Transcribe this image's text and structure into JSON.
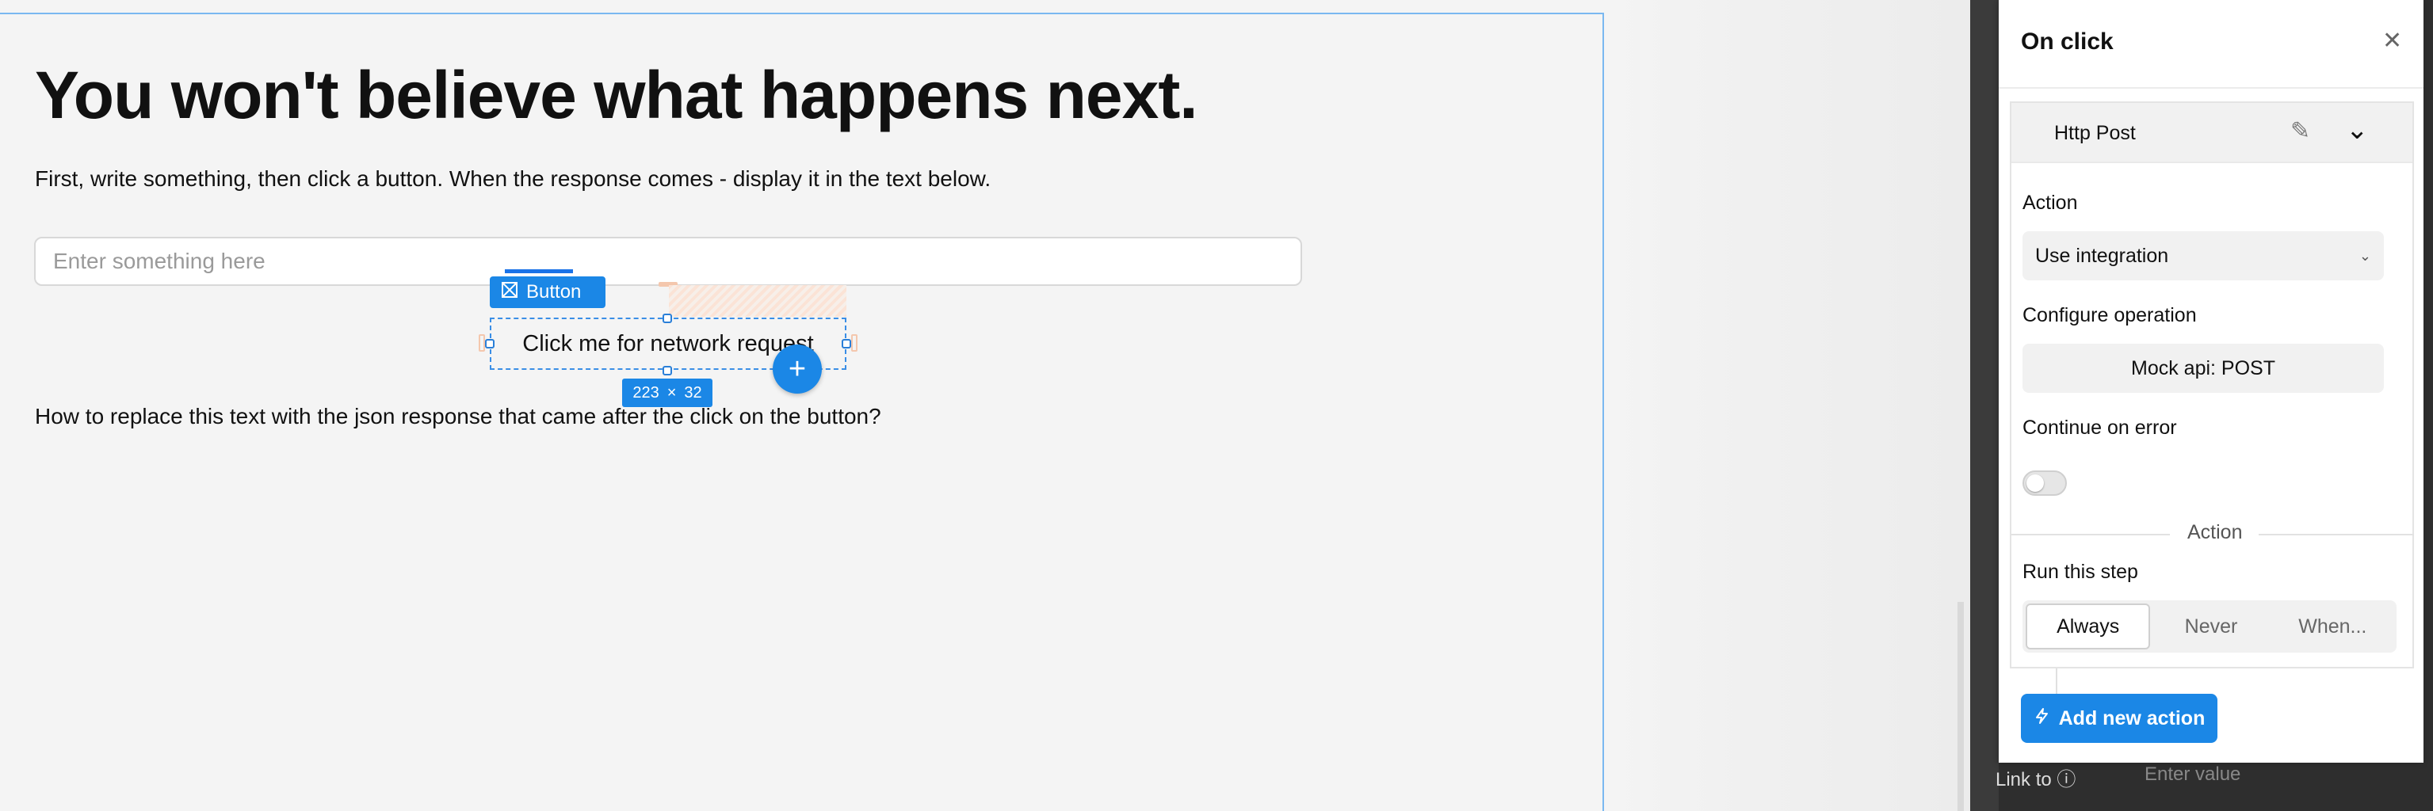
{
  "canvas": {
    "heading": "You won't believe what happens next.",
    "intro": "First, write something, then click a button. When the response comes - display it in the text below.",
    "input_placeholder": "Enter something here",
    "button_label": "Click me for network request",
    "footer_text": "How to replace this text with the json response that came after the click on the button?"
  },
  "selection": {
    "component_chip": "Button",
    "component_icon": "component-icon",
    "size_w": "223",
    "size_sep": "×",
    "size_h": "32",
    "add_icon": "plus-icon"
  },
  "panel": {
    "title": "On click",
    "close_icon": "close-icon",
    "card_title": "Http Post",
    "action_label": "Action",
    "action_value": "Use integration",
    "configure_label": "Configure operation",
    "operation_value": "Mock api: POST",
    "continue_label": "Continue on error",
    "continue_on_error": false,
    "divider_label": "Action",
    "run_label": "Run this step",
    "run_options": [
      "Always",
      "Never",
      "When..."
    ],
    "run_selected": "Always",
    "add_action": "Add new action"
  },
  "behind": {
    "link_label": "Link to",
    "link_placeholder": "Enter value"
  },
  "colors": {
    "accent": "#1b87e6",
    "selection_border": "#3a8ee6"
  }
}
